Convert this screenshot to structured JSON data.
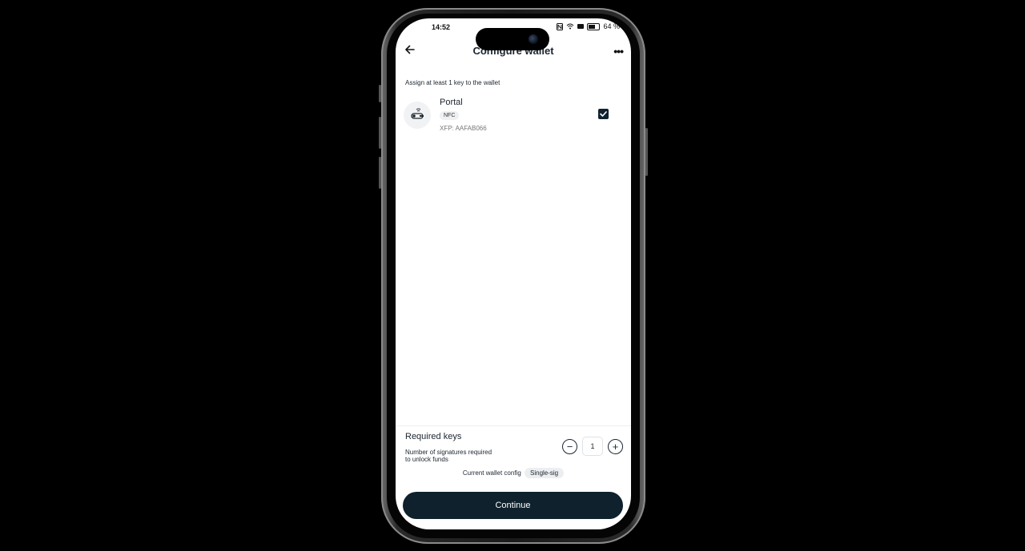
{
  "status": {
    "time": "14:52",
    "battery": "64 %"
  },
  "header": {
    "title": "Configure wallet"
  },
  "instructions": "Assign at least 1 key to the wallet",
  "key": {
    "name": "Portal",
    "badge": "NFC",
    "xfp": "XFP: AAFAB066",
    "selected": true
  },
  "required_keys": {
    "title": "Required keys",
    "description": "Number of signatures required to unlock funds",
    "value": "1",
    "minus_label": "−",
    "plus_label": "+"
  },
  "config": {
    "label": "Current wallet config",
    "value": "Single-sig"
  },
  "continue_label": "Continue",
  "colors": {
    "primary": "#0e212c",
    "background": "#ffffff",
    "badge": "#eceef0"
  }
}
